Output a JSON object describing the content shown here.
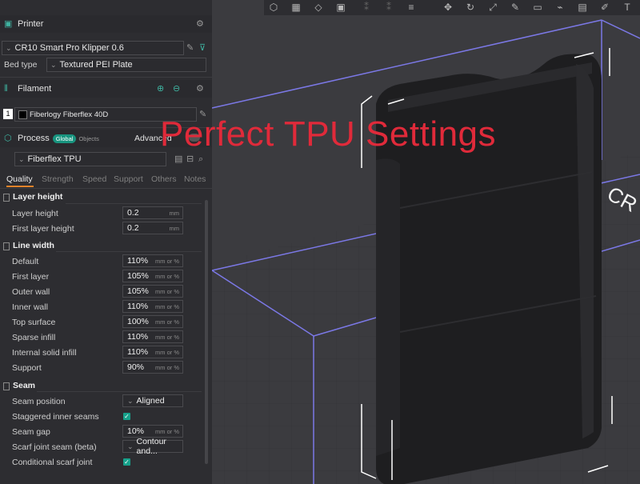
{
  "overlay_title": "Perfect TPU Settings",
  "printer": {
    "section_title": "Printer",
    "preset": "CR10 Smart Pro Klipper 0.6",
    "bed_type_label": "Bed type",
    "bed_type_value": "Textured PEI Plate"
  },
  "filament": {
    "section_title": "Filament",
    "slot": "1",
    "preset": "Fiberlogy Fiberflex 40D"
  },
  "process": {
    "section_title": "Process",
    "global_pill": "Global",
    "objects_pill": "Objects",
    "advanced_label": "Advanced",
    "preset": "Fiberflex TPU",
    "tabs": [
      "Quality",
      "Strength",
      "Speed",
      "Support",
      "Others",
      "Notes"
    ]
  },
  "groups": {
    "layer_height": "Layer height",
    "line_width": "Line width",
    "seam": "Seam"
  },
  "settings": {
    "layer_height": {
      "label": "Layer height",
      "value": "0.2",
      "unit": "mm"
    },
    "first_layer_height": {
      "label": "First layer height",
      "value": "0.2",
      "unit": "mm"
    },
    "lw_default": {
      "label": "Default",
      "value": "110%",
      "unit": "mm or %"
    },
    "lw_first_layer": {
      "label": "First layer",
      "value": "105%",
      "unit": "mm or %"
    },
    "lw_outer_wall": {
      "label": "Outer wall",
      "value": "105%",
      "unit": "mm or %"
    },
    "lw_inner_wall": {
      "label": "Inner wall",
      "value": "110%",
      "unit": "mm or %"
    },
    "lw_top_surface": {
      "label": "Top surface",
      "value": "100%",
      "unit": "mm or %"
    },
    "lw_sparse_infill": {
      "label": "Sparse infill",
      "value": "110%",
      "unit": "mm or %"
    },
    "lw_internal_solid_infill": {
      "label": "Internal solid infill",
      "value": "110%",
      "unit": "mm or %"
    },
    "lw_support": {
      "label": "Support",
      "value": "90%",
      "unit": "mm or %"
    },
    "seam_position": {
      "label": "Seam position",
      "value": "Aligned"
    },
    "staggered_inner_seams": {
      "label": "Staggered inner seams",
      "checked": true
    },
    "seam_gap": {
      "label": "Seam gap",
      "value": "10%",
      "unit": "mm or %"
    },
    "scarf_joint_seam": {
      "label": "Scarf joint seam (beta)",
      "value": "Contour and..."
    },
    "conditional_scarf_joint": {
      "label": "Conditional scarf joint",
      "checked": true
    }
  },
  "colors": {
    "accent": "#16a08a",
    "tab_underline": "#e3832a",
    "overlay_text": "#e02a3a",
    "bed_box": "#7b78e6"
  }
}
